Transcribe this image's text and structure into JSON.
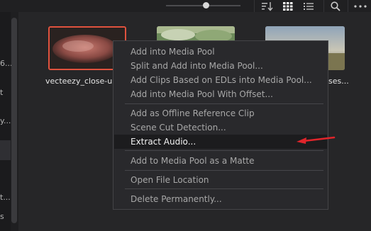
{
  "left_panel": {
    "items": [
      "6...",
      "t",
      "y...",
      "t...",
      "s"
    ]
  },
  "media": {
    "clips": [
      {
        "label": "vecteezy_close-up"
      },
      {
        "label": ""
      },
      {
        "label": "ses..."
      }
    ]
  },
  "context_menu": {
    "group1": [
      "Add into Media Pool",
      "Split and Add into Media Pool...",
      "Add Clips Based on EDLs into Media Pool...",
      "Add into Media Pool With Offset..."
    ],
    "group2": [
      "Add as Offline Reference Clip",
      "Scene Cut Detection...",
      "Extract Audio..."
    ],
    "group3": [
      "Add to Media Pool as a Matte"
    ],
    "group4": [
      "Open File Location"
    ],
    "group5": [
      "Delete Permanently..."
    ]
  },
  "annotation": {
    "arrow_color": "#e0252b"
  },
  "colors": {
    "selection_border": "#e0523e",
    "accent_highlight": "#f2f2f2"
  },
  "icons": [
    "sort-icon",
    "grid-view-icon",
    "list-view-icon",
    "search-icon",
    "more-icon"
  ]
}
